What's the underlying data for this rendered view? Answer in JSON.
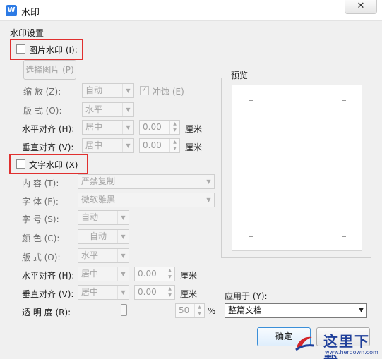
{
  "window": {
    "icon_letter": "W",
    "title": "水印",
    "close_glyph": "✕"
  },
  "section": {
    "title": "水印设置"
  },
  "picture": {
    "checkbox_label": "图片水印 (I):",
    "select_button": "选择图片 (P)",
    "scale_label": "缩  放 (Z):",
    "scale_value": "自动",
    "washout_label": "冲蚀 (E)",
    "layout_label": "版  式 (O):",
    "layout_value": "水平",
    "halign_label": "水平对齐 (H):",
    "halign_value": "居中",
    "halign_offset": "0.00",
    "valign_label": "垂直对齐 (V):",
    "valign_value": "居中",
    "valign_offset": "0.00",
    "unit": "厘米"
  },
  "text": {
    "checkbox_label": "文字水印 (X)",
    "content_label": "内  容 (T):",
    "content_value": "严禁复制",
    "font_label": "字  体 (F):",
    "font_value": "微软雅黑",
    "size_label": "字  号 (S):",
    "size_value": "自动",
    "color_label": "颜  色 (C):",
    "color_value": "自动",
    "layout_label": "版  式 (O):",
    "layout_value": "水平",
    "halign_label": "水平对齐 (H):",
    "halign_value": "居中",
    "halign_offset": "0.00",
    "valign_label": "垂直对齐 (V):",
    "valign_value": "居中",
    "valign_offset": "0.00",
    "unit": "厘米",
    "transparency_label": "透 明 度 (R):",
    "transparency_value": "50",
    "transparency_unit": "%"
  },
  "preview": {
    "label": "预览"
  },
  "apply": {
    "label": "应用于 (Y):",
    "value": "整篇文档"
  },
  "buttons": {
    "ok": "确定"
  },
  "site_watermark": {
    "title": "这里下载",
    "url": "www.herdown.com"
  },
  "colors": {
    "highlight": "#e0302f",
    "brand_blue": "#2d7be5"
  }
}
